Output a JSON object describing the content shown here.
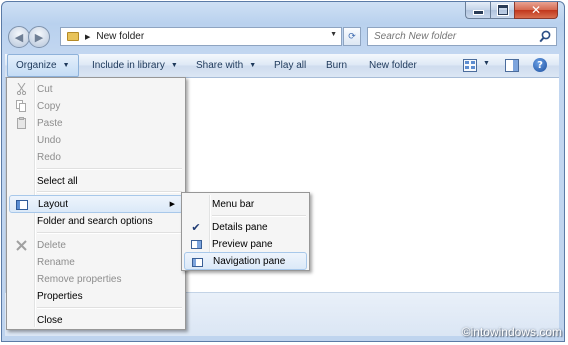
{
  "window": {
    "minimize_glyph": "–",
    "maximize_glyph": "□",
    "close_glyph": "✕"
  },
  "nav": {
    "back_glyph": "◀",
    "forward_glyph": "▶",
    "breadcrumb_arrow": "▶",
    "address_text": "New folder",
    "address_dropdown_glyph": "▼",
    "refresh_glyph": "⟳",
    "search_placeholder": "Search New folder"
  },
  "toolbar": {
    "organize": "Organize",
    "include_in_library": "Include in library",
    "share_with": "Share with",
    "play_all": "Play all",
    "burn": "Burn",
    "new_folder": "New folder",
    "caret": "▼",
    "help": "?"
  },
  "organize_menu": {
    "items": [
      {
        "label": "Cut",
        "disabled": true,
        "icon": "scissors-icon"
      },
      {
        "label": "Copy",
        "disabled": true,
        "icon": "copy-icon"
      },
      {
        "label": "Paste",
        "disabled": true,
        "icon": "paste-icon"
      },
      {
        "label": "Undo",
        "disabled": true
      },
      {
        "label": "Redo",
        "disabled": true
      },
      {
        "label": "Select all",
        "disabled": false
      },
      {
        "label": "Layout",
        "disabled": false,
        "icon": "layout-icon",
        "submenu": true,
        "highlighted": true
      },
      {
        "label": "Folder and search options",
        "disabled": false
      },
      {
        "label": "Delete",
        "disabled": true,
        "icon": "delete-icon"
      },
      {
        "label": "Rename",
        "disabled": true
      },
      {
        "label": "Remove properties",
        "disabled": true
      },
      {
        "label": "Properties",
        "disabled": false
      },
      {
        "label": "Close",
        "disabled": false
      }
    ],
    "submenu_arrow": "▶"
  },
  "layout_submenu": {
    "items": [
      {
        "label": "Menu bar",
        "checked": false
      },
      {
        "label": "Details pane",
        "checked": true
      },
      {
        "label": "Preview pane",
        "icon": "preview-pane-icon"
      },
      {
        "label": "Navigation pane",
        "icon": "navigation-pane-icon",
        "highlighted": true
      }
    ],
    "check_glyph": "✔"
  },
  "watermark": "©intowindows.com",
  "colors": {
    "frame": "#bfd4ee",
    "toolbar_text": "#1e395b",
    "disabled_text": "#8d8d8d",
    "highlight_border": "#a8c8ea"
  }
}
